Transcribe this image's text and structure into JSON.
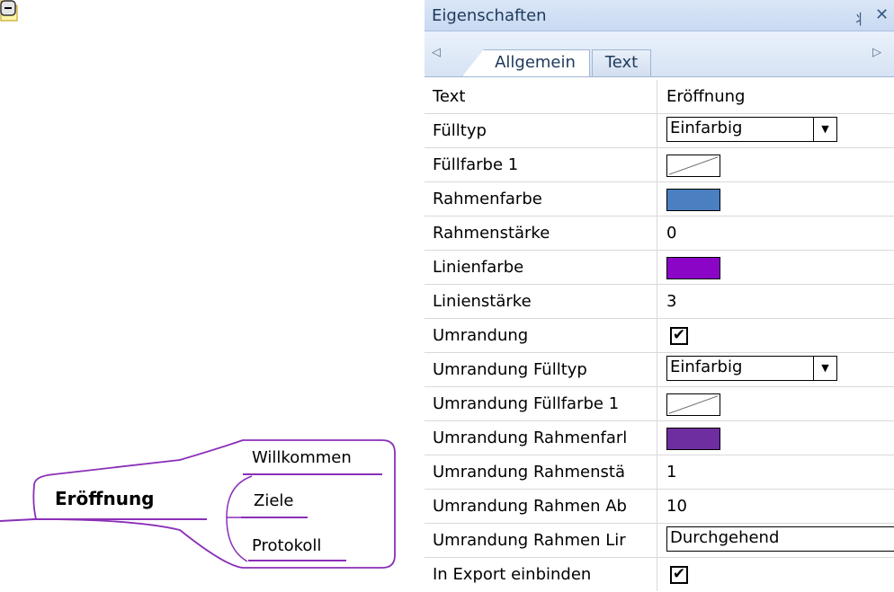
{
  "mindmap": {
    "central_topic": "Eröffnung",
    "subtopics": [
      "Willkommen",
      "Ziele",
      "Protokoll"
    ],
    "branch_color": "#8a2fb8",
    "collapse_symbol": "−"
  },
  "panel": {
    "title": "Eigenschaften",
    "pin_icon": "pin-icon",
    "close_icon": "close-icon",
    "tab_scroll_left": "◁",
    "tab_scroll_right": "▷",
    "tabs": [
      {
        "label": "Allgemein",
        "active": true
      },
      {
        "label": "Text",
        "active": false
      }
    ],
    "dropdown_arrow": "▼",
    "checkmark": "✔",
    "properties": [
      {
        "label": "Text",
        "type": "text",
        "value": "Eröffnung"
      },
      {
        "label": "Fülltyp",
        "type": "dropdown",
        "value": "Einfarbig"
      },
      {
        "label": "Füllfarbe 1",
        "type": "swatch-none"
      },
      {
        "label": "Rahmenfarbe",
        "type": "swatch",
        "color": "#4a7fc1"
      },
      {
        "label": "Rahmenstärke",
        "type": "text",
        "value": "0"
      },
      {
        "label": "Linienfarbe",
        "type": "swatch",
        "color": "#8b05c7"
      },
      {
        "label": "Linienstärke",
        "type": "text",
        "value": "3"
      },
      {
        "label": "Umrandung",
        "type": "checkbox",
        "checked": true
      },
      {
        "label": "Umrandung Fülltyp",
        "type": "dropdown",
        "value": "Einfarbig"
      },
      {
        "label": "Umrandung Füllfarbe 1",
        "type": "swatch-none"
      },
      {
        "label": "Umrandung Rahmenfarl",
        "type": "swatch",
        "color": "#6e2ea0"
      },
      {
        "label": "Umrandung Rahmenstä",
        "type": "text",
        "value": "1"
      },
      {
        "label": "Umrandung Rahmen Ab",
        "type": "text",
        "value": "10"
      },
      {
        "label": "Umrandung Rahmen Lir",
        "type": "dropdown-wide",
        "value": "Durchgehend"
      },
      {
        "label": "In Export einbinden",
        "type": "checkbox",
        "checked": true
      }
    ]
  }
}
